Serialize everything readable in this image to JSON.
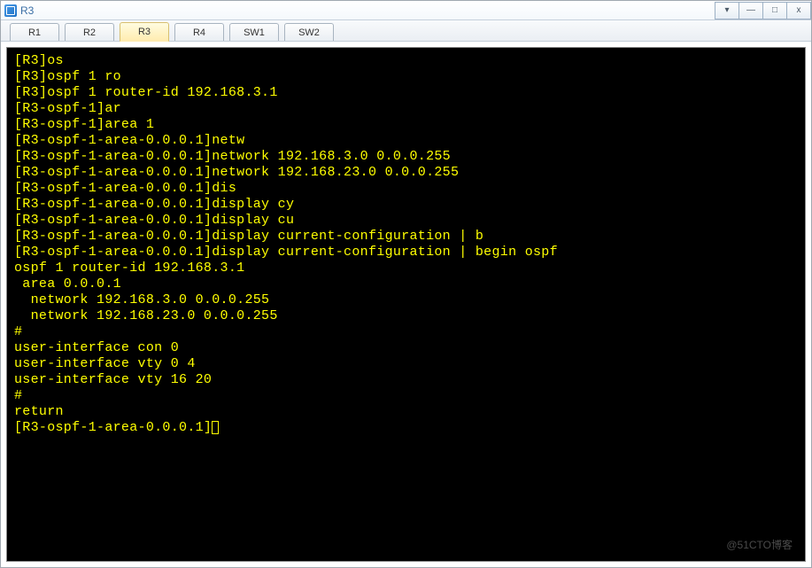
{
  "title": "R3",
  "winControls": {
    "drop": "▾",
    "min": "—",
    "max": "□",
    "close": "x"
  },
  "tabs": [
    {
      "label": "R1",
      "active": false
    },
    {
      "label": "R2",
      "active": false
    },
    {
      "label": "R3",
      "active": true
    },
    {
      "label": "R4",
      "active": false
    },
    {
      "label": "SW1",
      "active": false
    },
    {
      "label": "SW2",
      "active": false
    }
  ],
  "terminal": {
    "lines": [
      "[R3]os",
      "[R3]ospf 1 ro",
      "[R3]ospf 1 router-id 192.168.3.1",
      "[R3-ospf-1]ar",
      "[R3-ospf-1]area 1",
      "[R3-ospf-1-area-0.0.0.1]netw",
      "[R3-ospf-1-area-0.0.0.1]network 192.168.3.0 0.0.0.255",
      "[R3-ospf-1-area-0.0.0.1]network 192.168.23.0 0.0.0.255",
      "[R3-ospf-1-area-0.0.0.1]dis",
      "[R3-ospf-1-area-0.0.0.1]display cy",
      "[R3-ospf-1-area-0.0.0.1]display cu",
      "[R3-ospf-1-area-0.0.0.1]display current-configuration | b",
      "[R3-ospf-1-area-0.0.0.1]display current-configuration | begin ospf",
      "ospf 1 router-id 192.168.3.1",
      " area 0.0.0.1",
      "  network 192.168.3.0 0.0.0.255",
      "  network 192.168.23.0 0.0.0.255",
      "#",
      "user-interface con 0",
      "user-interface vty 0 4",
      "user-interface vty 16 20",
      "#",
      "return"
    ],
    "prompt": "[R3-ospf-1-area-0.0.0.1]"
  },
  "watermark": "@51CTO博客"
}
